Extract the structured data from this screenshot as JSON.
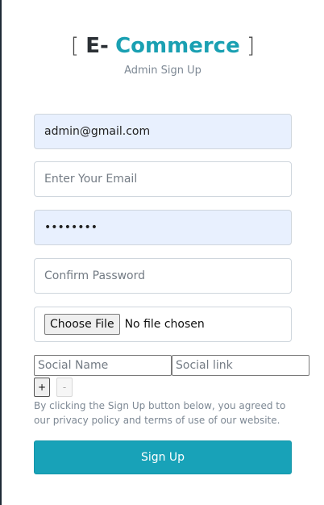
{
  "brand": {
    "open_bracket": "[",
    "e_text": "E-",
    "commerce_text": "Commerce",
    "close_bracket": "]"
  },
  "subtitle": "Admin Sign Up",
  "form": {
    "email_value": "admin@gmail.com",
    "email2_placeholder": "Enter Your Email",
    "password_value": "••••••••",
    "confirm_placeholder": "Confirm Password",
    "file_button_label": "Choose File",
    "file_status": "No file chosen",
    "social_name_placeholder": "Social Name",
    "social_link_placeholder": "Social link",
    "add_label": "+",
    "remove_label": "-",
    "terms_text": "By clicking the Sign Up button below, you agreed to our privacy policy and terms of use of our website.",
    "submit_label": "Sign Up"
  },
  "colors": {
    "accent": "#18a2b8",
    "autofill_bg": "#e8f0fe",
    "muted_text": "#7d8894"
  }
}
